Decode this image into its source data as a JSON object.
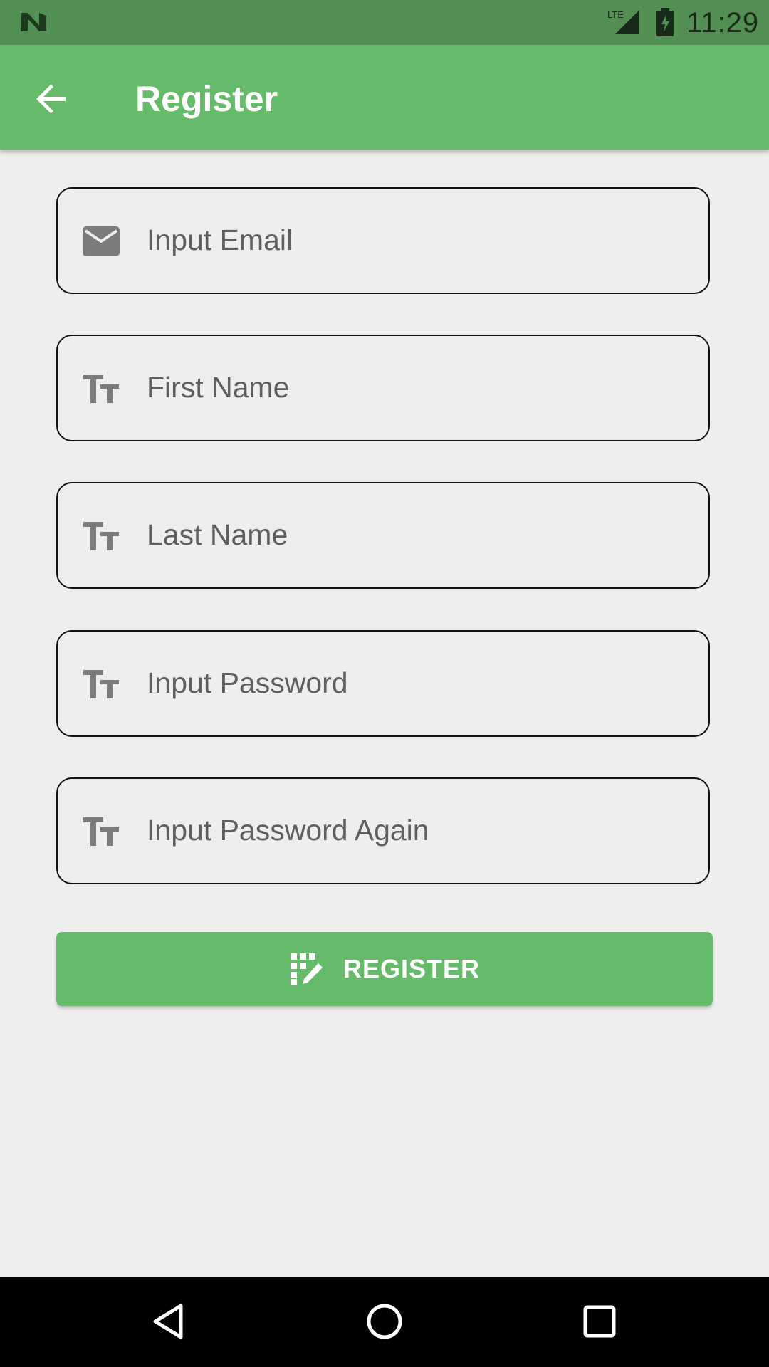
{
  "status_bar": {
    "time": "11:29",
    "network_label": "LTE",
    "icons": [
      "n-logo-icon",
      "lte-signal-icon",
      "battery-charging-icon"
    ]
  },
  "app_bar": {
    "title": "Register",
    "back_icon": "arrow-back-icon",
    "color": "#66bb6a"
  },
  "form": {
    "fields": [
      {
        "placeholder": "Input Email",
        "icon": "email-icon"
      },
      {
        "placeholder": "First Name",
        "icon": "text-fields-icon"
      },
      {
        "placeholder": "Last Name",
        "icon": "text-fields-icon"
      },
      {
        "placeholder": "Input Password",
        "icon": "text-fields-icon"
      },
      {
        "placeholder": "Input Password Again",
        "icon": "text-fields-icon"
      }
    ]
  },
  "register_button": {
    "label": "REGISTER",
    "icon": "app-registration-icon",
    "color": "#66bb6a"
  },
  "nav_bar": {
    "icons": [
      "nav-back-icon",
      "nav-home-icon",
      "nav-recents-icon"
    ]
  }
}
